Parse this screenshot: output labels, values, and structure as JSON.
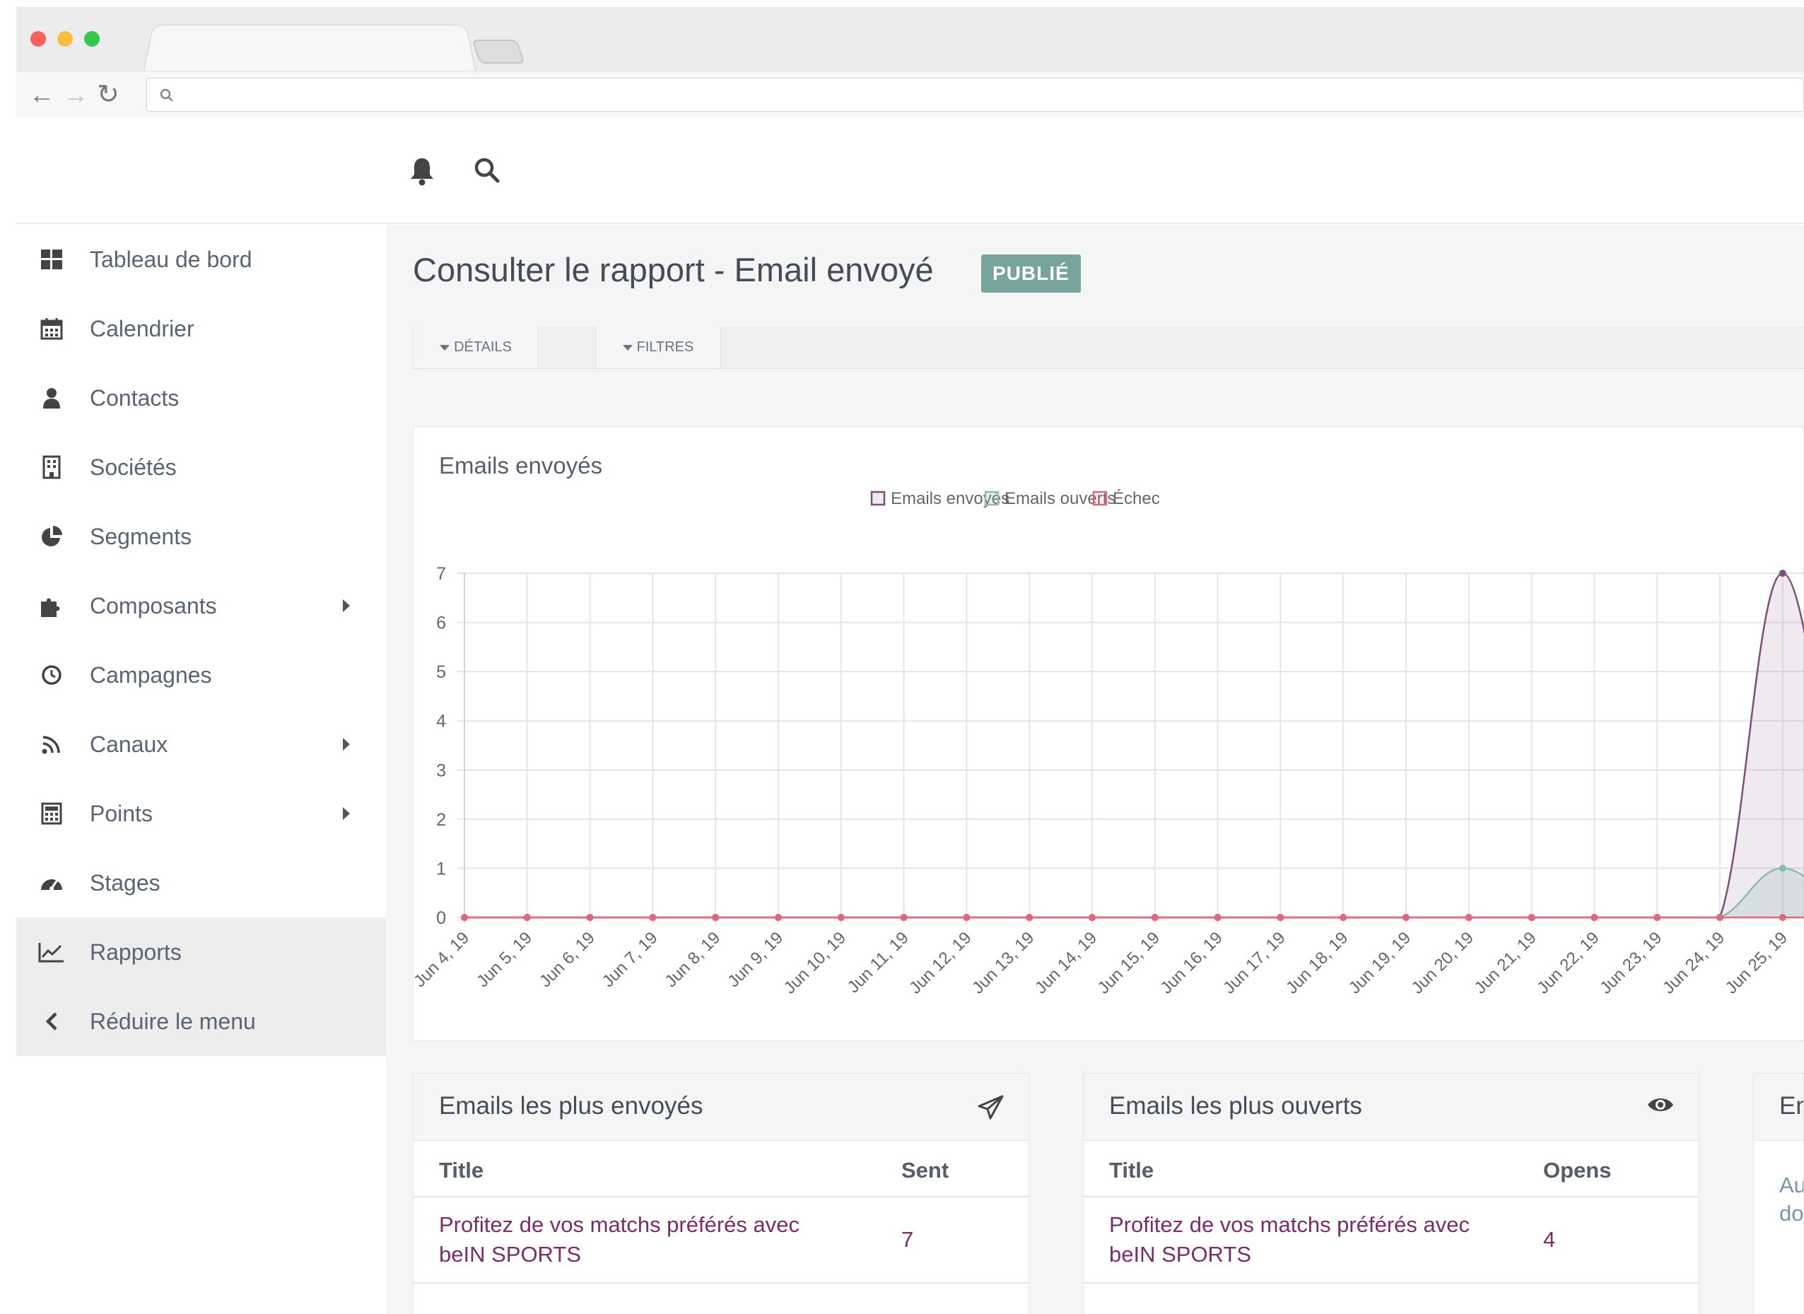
{
  "sidebar": {
    "items": [
      {
        "label": "Tableau de bord",
        "icon": "dashboard-icon"
      },
      {
        "label": "Calendrier",
        "icon": "calendar-icon"
      },
      {
        "label": "Contacts",
        "icon": "user-icon"
      },
      {
        "label": "Sociétés",
        "icon": "building-icon"
      },
      {
        "label": "Segments",
        "icon": "pie-chart-icon"
      },
      {
        "label": "Composants",
        "icon": "puzzle-icon"
      },
      {
        "label": "Campagnes",
        "icon": "clock-icon"
      },
      {
        "label": "Canaux",
        "icon": "rss-icon"
      },
      {
        "label": "Points",
        "icon": "calculator-icon"
      },
      {
        "label": "Stages",
        "icon": "tachometer-icon"
      },
      {
        "label": "Rapports",
        "icon": "line-chart-icon"
      }
    ],
    "collapse_label": "Réduire le menu"
  },
  "page": {
    "title": "Consulter le rapport - Email envoyé",
    "badge": "PUBLIÉ",
    "details_label": "DÉTAILS",
    "filters_label": "FILTRES"
  },
  "chart_card": {
    "title": "Emails envoyés"
  },
  "colors": {
    "sent": "#7a4f78",
    "opened": "#8fb9b4",
    "failed": "#e0677e",
    "badge": "#78a49e",
    "link": "#7a2d6a"
  },
  "chart_data": {
    "type": "line",
    "x": [
      "Jun 4, 19",
      "Jun 5, 19",
      "Jun 6, 19",
      "Jun 7, 19",
      "Jun 8, 19",
      "Jun 9, 19",
      "Jun 10, 19",
      "Jun 11, 19",
      "Jun 12, 19",
      "Jun 13, 19",
      "Jun 14, 19",
      "Jun 15, 19",
      "Jun 16, 19",
      "Jun 17, 19",
      "Jun 18, 19",
      "Jun 19, 19",
      "Jun 20, 19",
      "Jun 21, 19",
      "Jun 22, 19",
      "Jun 23, 19",
      "Jun 24, 19",
      "Jun 25, 19"
    ],
    "series": [
      {
        "name": "Emails envoyés",
        "values": [
          0,
          0,
          0,
          0,
          0,
          0,
          0,
          0,
          0,
          0,
          0,
          0,
          0,
          0,
          0,
          0,
          0,
          0,
          0,
          0,
          0,
          7
        ]
      },
      {
        "name": "Emails ouverts",
        "values": [
          0,
          0,
          0,
          0,
          0,
          0,
          0,
          0,
          0,
          0,
          0,
          0,
          0,
          0,
          0,
          0,
          0,
          0,
          0,
          0,
          0,
          1
        ]
      },
      {
        "name": "Échec",
        "values": [
          0,
          0,
          0,
          0,
          0,
          0,
          0,
          0,
          0,
          0,
          0,
          0,
          0,
          0,
          0,
          0,
          0,
          0,
          0,
          0,
          0,
          0
        ]
      }
    ],
    "y_ticks": [
      "0",
      "1",
      "2",
      "3",
      "4",
      "5",
      "6",
      "7"
    ],
    "ylim": [
      0,
      7
    ],
    "grid": true,
    "legend": "top-center",
    "area_fill": true
  },
  "tables": {
    "most_sent": {
      "title": "Emails les plus envoyés",
      "col_title": "Title",
      "col_value": "Sent",
      "rows": [
        {
          "title": "Profitez de vos matchs préférés avec beIN SPORTS",
          "value": "7"
        }
      ]
    },
    "most_opened": {
      "title": "Emails les plus ouverts",
      "col_title": "Title",
      "col_value": "Opens",
      "rows": [
        {
          "title": "Profitez de vos matchs préférés avec beIN SPORTS",
          "value": "4"
        }
      ]
    },
    "third": {
      "title_partial": "En",
      "text_partial_1": "Au",
      "text_partial_2": "do"
    }
  }
}
